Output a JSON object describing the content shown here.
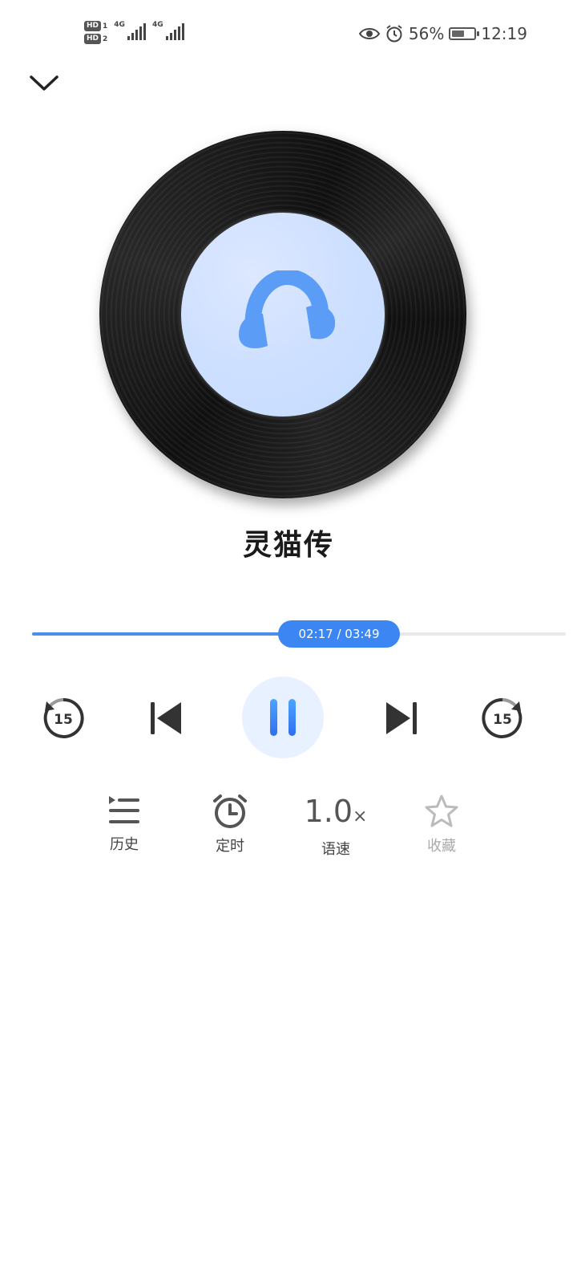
{
  "status": {
    "sim1": "HD",
    "sim1_slot": "1",
    "sim2": "HD",
    "sim2_slot": "2",
    "network1": "4G",
    "network2": "4G",
    "battery_percent": "56%",
    "battery_level": 0.56,
    "time": "12:19"
  },
  "player": {
    "title": "灵猫传",
    "progress_text": "02:17 / 03:49",
    "progress_fraction": 0.598,
    "rewind_seconds": "15",
    "forward_seconds": "15"
  },
  "tools": {
    "history_label": "历史",
    "timer_label": "定时",
    "speed_value": "1.0",
    "speed_suffix": "×",
    "speed_label": "语速",
    "favorite_label": "收藏"
  },
  "colors": {
    "accent": "#3b86f2",
    "progress_fill": "#4a90e8",
    "icon_blue": "#5b9cf6"
  }
}
